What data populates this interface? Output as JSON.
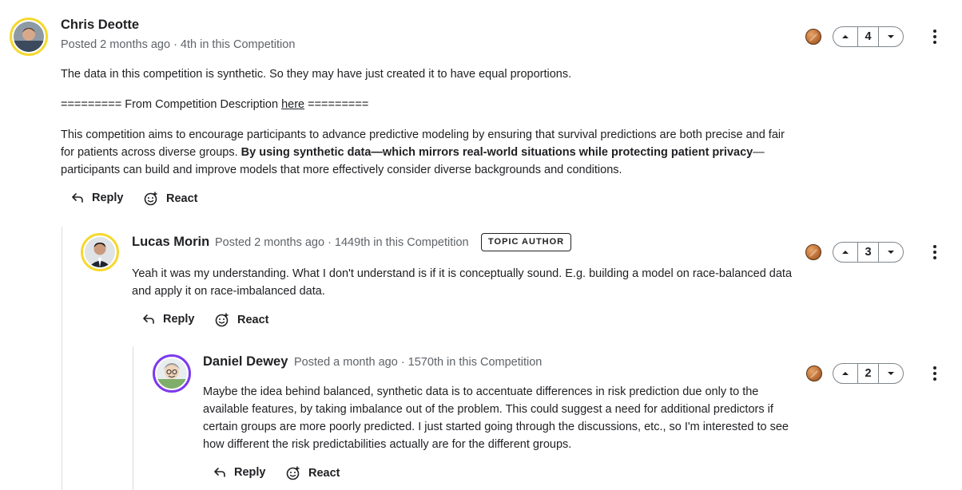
{
  "comments": [
    {
      "author": "Chris Deotte",
      "posted": "Posted 2 months ago",
      "rank": " · 4th in this Competition",
      "votes": "4",
      "paragraphs": {
        "p1": "The data in this competition is synthetic. So they may have just created it to have equal proportions.",
        "p2_pre": "========= From Competition Description ",
        "p2_link": "here",
        "p2_post": " =========",
        "p3_pre": "This competition aims to encourage participants to advance predictive modeling by ensuring that survival predictions are both precise and fair for patients across diverse groups. ",
        "p3_bold": "By using synthetic data—which mirrors real-world situations while protecting patient privacy",
        "p3_post": "—participants can build and improve models that more effectively consider diverse backgrounds and conditions."
      },
      "reply_label": "Reply",
      "react_label": "React"
    },
    {
      "author": "Lucas Morin",
      "posted": "Posted 2 months ago",
      "rank": " · 1449th in this Competition",
      "badge": "TOPIC AUTHOR",
      "votes": "3",
      "text": "Yeah it was my understanding. What I don't understand is if it is conceptually sound. E.g. building a model on race-balanced data and apply it on race-imbalanced data.",
      "reply_label": "Reply",
      "react_label": "React"
    },
    {
      "author": "Daniel Dewey",
      "posted": "Posted a month ago",
      "rank": " · 1570th in this Competition",
      "votes": "2",
      "text": "Maybe the idea behind balanced, synthetic data is to accentuate differences in risk prediction due only to the available features, by taking imbalance out of the problem. This could suggest a need for additional predictors if certain groups are more poorly predicted. I just started going through the discussions, etc., so I'm interested to see how different the risk predictabilities actually are for the different groups.",
      "reply_label": "Reply",
      "react_label": "React"
    }
  ],
  "icons": {
    "medal": "bronze-medal-icon",
    "upvote": "caret-up-icon",
    "downvote": "caret-down-icon",
    "more": "more-vertical-icon",
    "reply": "reply-arrow-icon",
    "react": "add-reaction-icon"
  },
  "colors": {
    "avatar_ring_gold": "#f5d82e",
    "avatar_ring_purple": "#7c3aed",
    "medal_bronze": "#c87a3f"
  }
}
